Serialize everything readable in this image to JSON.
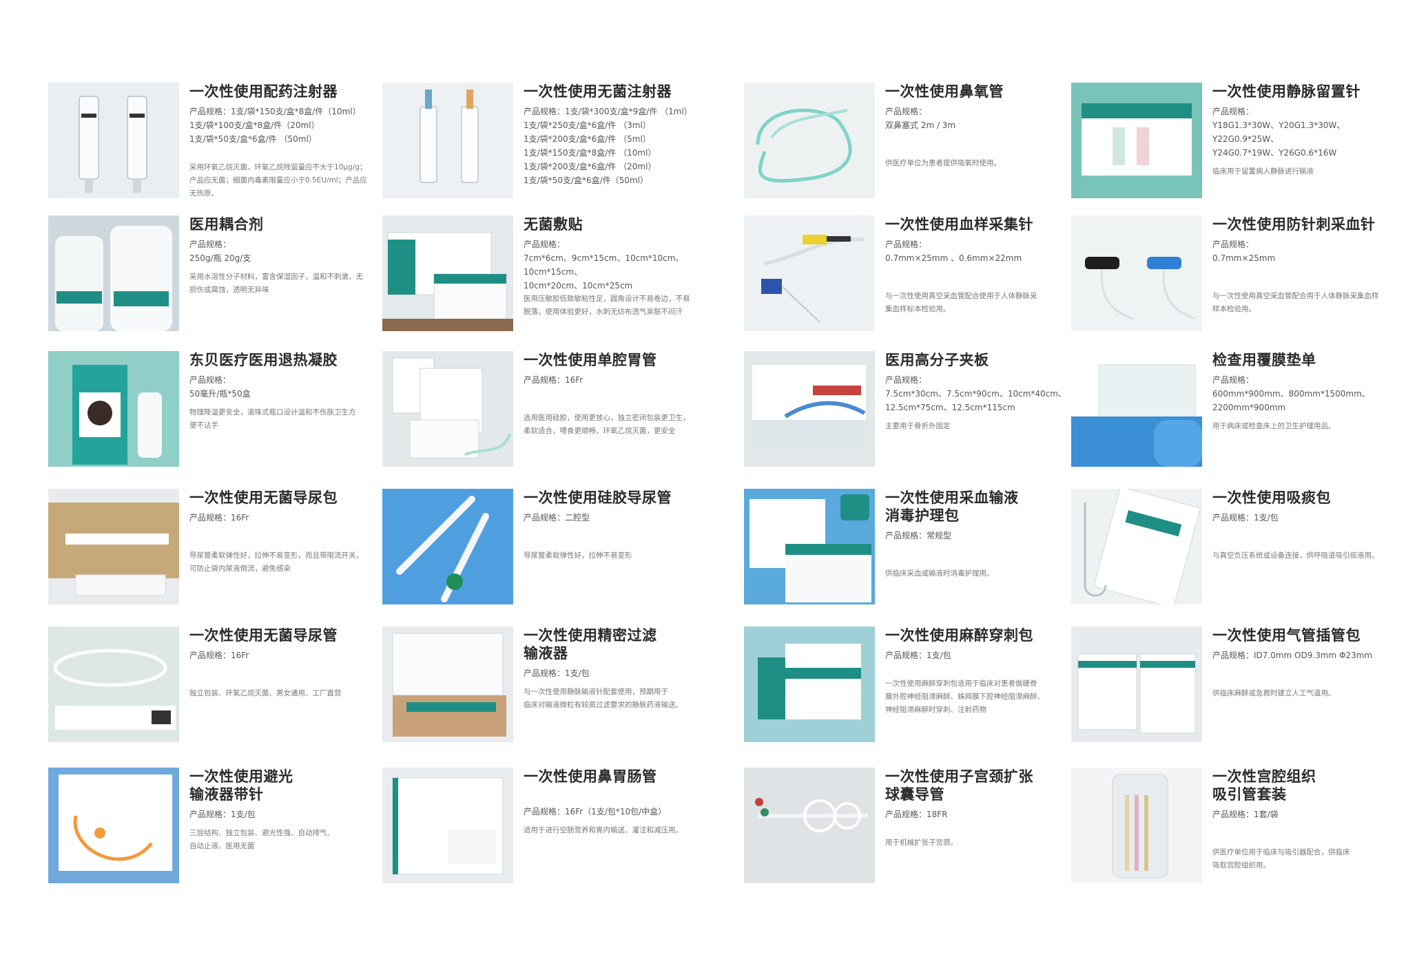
{
  "products": [
    {
      "title": "一次性使用配药注射器",
      "spec": "产品规格：1支/袋*150支/盒*8盒/件（10ml）\n1支/袋*100支/盒*8盒/件（20ml）\n1支/袋*50支/盒*6盒/件 （50ml）",
      "desc": "采用环氧乙烷灭菌，环氧乙烷残留量应不大于10μg/g；\n产品应无菌；细菌内毒素限量应小于0.5EU/ml；产品应\n无热原。"
    },
    {
      "title": "一次性使用无菌注射器",
      "spec": "产品规格：1支/袋*300支/盒*9盒/件 （1ml）\n1支/袋*250支/盒*6盒/件 （3ml）\n1支/袋*200支/盒*6盒/件 （5ml）\n1支/袋*150支/盒*8盒/件 （10ml）\n1支/袋*200支/盒*6盒/件 （20ml）\n1支/袋*50支/盒*6盒/件（50ml）",
      "desc": ""
    },
    {
      "title": "一次性使用鼻氧管",
      "spec": "产品规格：\n双鼻塞式 2m / 3m",
      "desc": "供医疗单位为患者提供吸氧时使用。"
    },
    {
      "title": "一次性使用静脉留置针",
      "spec": "产品规格：\nY18G1.3*30W、Y20G1.3*30W、Y22G0.9*25W、\nY24G0.7*19W、Y26G0.6*16W",
      "desc": "临床用于留置病人静脉进行输液"
    },
    {
      "title": "医用耦合剂",
      "spec": "产品规格：\n250g/瓶 20g/支",
      "desc": "采用水溶性分子材料，富含保湿因子，温和不刺激，无\n损伤或腐蚀，透明无异味"
    },
    {
      "title": "无菌敷贴",
      "spec": "产品规格：\n7cm*6cm、9cm*15cm、10cm*10cm、10cm*15cm、\n10cm*20cm、10cm*25cm",
      "desc": "医用压敏胶低致敏粘性足，圆角设计不易卷边，不易\n脱落，使用体验更好，水刺无纺布透气亲肤不闷汗"
    },
    {
      "title": "一次性使用血样采集针",
      "spec": "产品规格：\n0.7mm×25mm 、0.6mm×22mm",
      "desc": "与一次性使用真空采血管配合使用于人体静脉采\n集血样标本检验用。"
    },
    {
      "title": "一次性使用防针刺采血针",
      "spec": "产品规格：\n0.7mm×25mm",
      "desc": "与一次性使用真空采血管配合用于人体静脉采集血样\n样本检验用。"
    },
    {
      "title": "东贝医疗医用退热凝胶",
      "spec": "产品规格：\n50毫升/瓶*50盒",
      "desc": "物理降温更安全，滚珠式瓶口设计温和不伤肤卫生方\n便不沾手"
    },
    {
      "title": "一次性使用单腔胃管",
      "spec": "产品规格：16Fr",
      "desc": "选用医用硅胶，使用更放心，独立密闭包装更卫生，\n柔软适合，喂食更顺畅，环氧乙烷灭菌，更安全"
    },
    {
      "title": "医用高分子夹板",
      "spec": "产品规格：\n7.5cm*30cm、7.5cm*90cm、10cm*40cm、\n12.5cm*75cm、12.5cm*115cm",
      "desc": "主要用于骨折外固定"
    },
    {
      "title": "检查用覆膜垫单",
      "spec": "产品规格：\n600mm*900mm、800mm*1500mm、\n2200mm*900mm",
      "desc": "用于病床或检查床上的卫生护理用品。"
    },
    {
      "title": "一次性使用无菌导尿包",
      "spec": "产品规格：16Fr",
      "desc": "导尿管柔软弹性好，拉伸不易变形，而且带限流开关，\n可防止袋内尿液倒流，避免感染"
    },
    {
      "title": "一次性使用硅胶导尿管",
      "spec": "产品规格：二腔型",
      "desc": "导尿管柔软弹性好，拉伸不易变形"
    },
    {
      "title": "一次性使用采血输液\n消毒护理包",
      "spec": "产品规格：常规型",
      "desc": "供临床采血或输液时消毒护理用。"
    },
    {
      "title": "一次性使用吸痰包",
      "spec": "产品规格：1支/包",
      "desc": "与真空负压系统或设备连接，供呼吸道吸引痰液用。"
    },
    {
      "title": "一次性使用无菌导尿管",
      "spec": "产品规格：16Fr",
      "desc": "独立包装、环氧乙烷灭菌、男女通用、工厂直营"
    },
    {
      "title": "一次性使用精密过滤\n输液器",
      "spec": "产品规格：1支/包",
      "desc": "与一次性使用静脉输液针配套使用，预期用于\n临床对输液微粒有较高过滤要求的静脉药液输送。"
    },
    {
      "title": "一次性使用麻醉穿刺包",
      "spec": "产品规格：1支/包",
      "desc": "一次性使用麻醉穿刺包适用于临床对患者做硬脊\n膜外腔神经阻滞麻醉、蛛网膜下腔神经阻滞麻醉、\n神经阻滞麻醉时穿刺、注射药物"
    },
    {
      "title": "一次性使用气管插管包",
      "spec": "产品规格：ID7.0mm OD9.3mm Φ23mm",
      "desc": "供临床麻醉或急救时建立人工气道用。"
    },
    {
      "title": "一次性使用避光\n输液器带针",
      "spec": "产品规格：1支/包",
      "desc": "三层结构、独立包装、避光性强、自动排气、\n自动止液、医用无菌"
    },
    {
      "title": "一次性使用鼻胃肠管",
      "spec": "产品规格：16Fr（1支/包*10包/中盒）",
      "desc": "适用于进行空肠营养和胃内输送、灌注和减压用。"
    },
    {
      "title": "一次性使用子宫颈扩张\n球囊导管",
      "spec": "产品规格：18FR",
      "desc": "用于机械扩张子宫颈。"
    },
    {
      "title": "一次性宫腔组织\n吸引管套装",
      "spec": "产品规格：1套/袋",
      "desc": "供医疗单位用于临床与吸引器配合，供临床\n吸取宫腔组织用。"
    }
  ],
  "colors": {
    "title": "#2b2b2b",
    "spec": "#555555",
    "desc": "#777777",
    "accent": "#1f8f86"
  }
}
